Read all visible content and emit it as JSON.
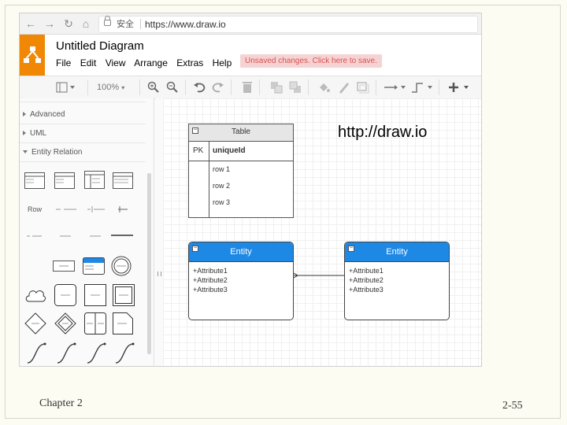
{
  "browser": {
    "secure_label": "安全",
    "url": "https://www.draw.io"
  },
  "app": {
    "title": "Untitled Diagram",
    "menu": [
      "File",
      "Edit",
      "View",
      "Arrange",
      "Extras",
      "Help"
    ],
    "unsaved_notice": "Unsaved changes. Click here to save.",
    "brand_color": "#f08705"
  },
  "toolbar": {
    "zoom": "100%"
  },
  "sidebar": {
    "sections": [
      {
        "label": "Advanced",
        "expanded": false
      },
      {
        "label": "UML",
        "expanded": false
      },
      {
        "label": "Entity Relation",
        "expanded": true
      }
    ],
    "labels": {
      "row": "Row",
      "entity": "Entity",
      "attribute": "Attribute"
    }
  },
  "canvas": {
    "annotation": "http://draw.io",
    "table": {
      "title": "Table",
      "pk_label": "PK",
      "pk_name": "uniqueId",
      "rows": [
        "row 1",
        "row 2",
        "row 3"
      ]
    },
    "entities": [
      {
        "title": "Entity",
        "attributes": [
          "+Attribute1",
          "+Attribute2",
          "+Attribute3"
        ]
      },
      {
        "title": "Entity",
        "attributes": [
          "+Attribute1",
          "+Attribute2",
          "+Attribute3"
        ]
      }
    ],
    "entity_color": "#1e88e5"
  },
  "slide": {
    "chapter": "Chapter 2",
    "page": "2-55"
  }
}
